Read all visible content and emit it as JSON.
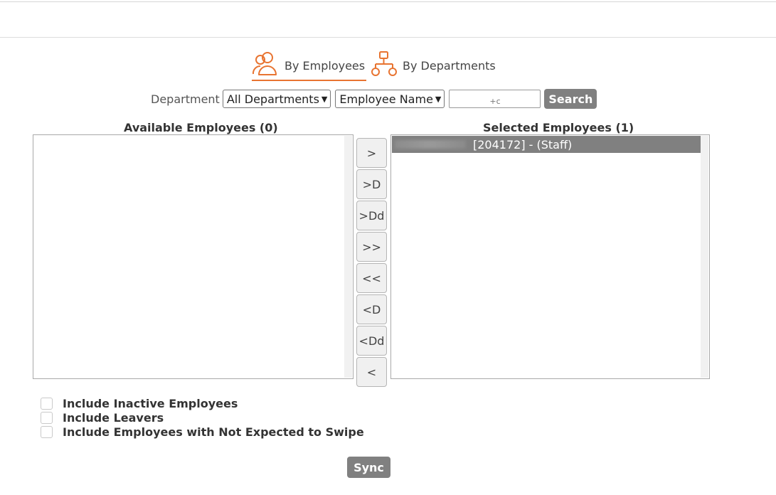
{
  "tabs": {
    "by_employees": "By Employees",
    "by_departments": "By Departments"
  },
  "filter": {
    "department_label": "Department",
    "department_select": "All Departments",
    "field_select": "Employee Name",
    "search_value": "+c",
    "search_button": "Search"
  },
  "available": {
    "title": "Available Employees (0)"
  },
  "selected": {
    "title": "Selected Employees (1)",
    "items": [
      "[204172] - (Staff)"
    ]
  },
  "move_buttons": [
    ">",
    ">D",
    ">Dd",
    ">>",
    "<<",
    "<D",
    "<Dd",
    "<"
  ],
  "options": [
    "Include Inactive Employees",
    "Include Leavers",
    "Include Employees with Not Expected to Swipe"
  ],
  "sync_button": "Sync",
  "colors": {
    "accent": "#e87431",
    "button_gray": "#808080",
    "selected_row": "#808080"
  }
}
